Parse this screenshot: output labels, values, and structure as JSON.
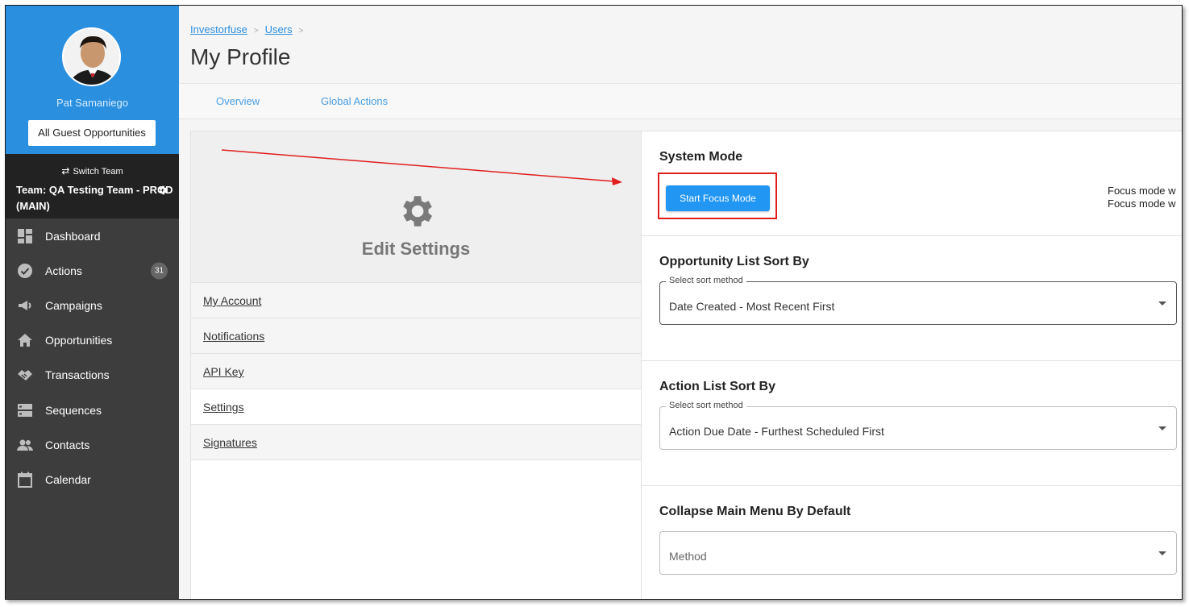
{
  "sidebar": {
    "user_name": "Pat Samaniego",
    "guest_button": "All Guest Opportunities",
    "switch_team": "Switch Team",
    "team_name": "Team: QA Testing Team - PROD (MAIN)",
    "nav": [
      {
        "label": "Dashboard",
        "icon": "dashboard-icon"
      },
      {
        "label": "Actions",
        "icon": "check-circle-icon",
        "badge": "31"
      },
      {
        "label": "Campaigns",
        "icon": "megaphone-icon"
      },
      {
        "label": "Opportunities",
        "icon": "home-icon"
      },
      {
        "label": "Transactions",
        "icon": "handshake-icon"
      },
      {
        "label": "Sequences",
        "icon": "sequences-icon"
      },
      {
        "label": "Contacts",
        "icon": "contacts-icon"
      },
      {
        "label": "Calendar",
        "icon": "calendar-icon"
      }
    ]
  },
  "breadcrumb": [
    "Investorfuse",
    "Users"
  ],
  "page_title": "My Profile",
  "tabs": [
    "Overview",
    "Global Actions"
  ],
  "settings_panel": {
    "title": "Edit Settings",
    "menu": [
      "My Account",
      "Notifications",
      "API Key",
      "Settings",
      "Signatures"
    ],
    "active": "Settings"
  },
  "system_mode": {
    "title": "System Mode",
    "button": "Start Focus Mode",
    "desc_line1": "Focus mode w",
    "desc_line2": "Focus mode w"
  },
  "opportunity_sort": {
    "title": "Opportunity List Sort By",
    "label": "Select sort method",
    "value": "Date Created - Most Recent First"
  },
  "action_sort": {
    "title": "Action List Sort By",
    "label": "Select sort method",
    "value": "Action Due Date - Furthest Scheduled First"
  },
  "collapse_menu": {
    "title": "Collapse Main Menu By Default",
    "placeholder": "Method"
  },
  "colors": {
    "sidebar_blue": "#2b8fe0",
    "sidebar_dark": "#3d3d3d",
    "primary_button": "#2196f3",
    "annotation_red": "#e01e1e"
  }
}
